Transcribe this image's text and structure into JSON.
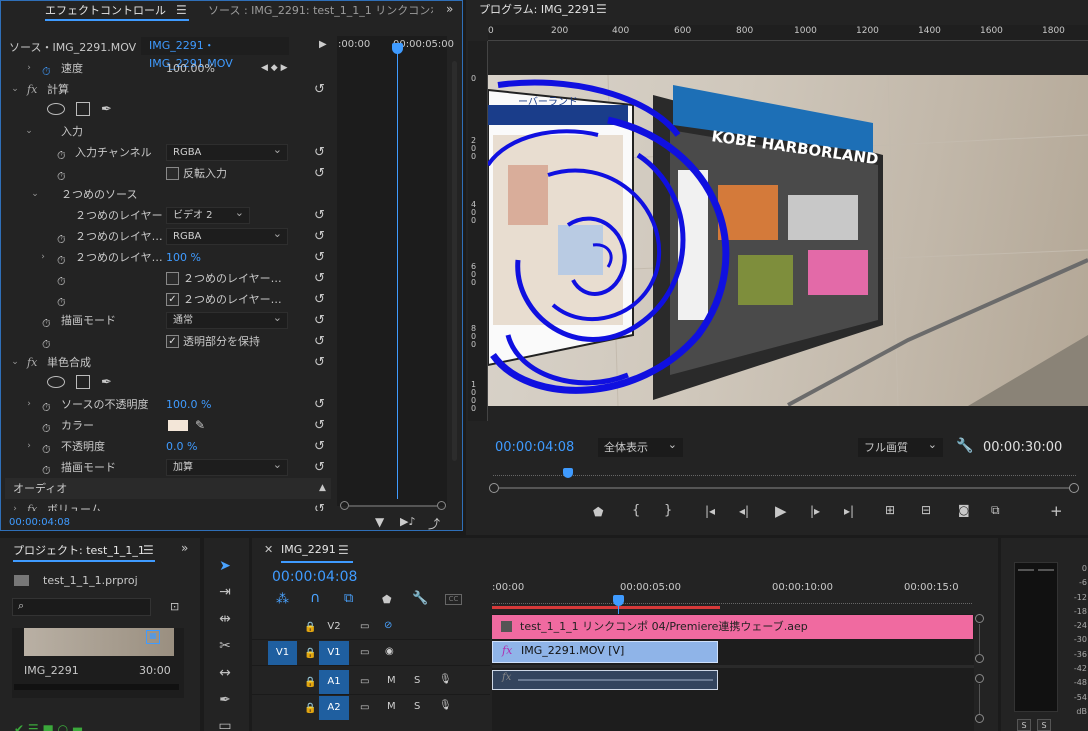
{
  "effect_controls": {
    "tab_title": "エフェクトコントロール",
    "source_tab": "ソース : IMG_2291: test_1_1_1 リンクコンポ (",
    "source_label": "ソース・IMG_2291.MOV",
    "clip_label": "IMG_2291・IMG_2291.MOV",
    "ruler_start": ":00:00",
    "ruler_mid": "00:00:05:00",
    "current_time": "00:00:04:08",
    "rows": {
      "speed_label": "速度",
      "speed_value": "100.00%",
      "calc_label": "計算",
      "input_label": "入力",
      "input_channel_label": "入力チャンネル",
      "input_channel_value": "RGBA",
      "invert_input_label": "反転入力",
      "second_source_label": "２つめのソース",
      "second_layer_label": "２つめのレイヤー",
      "second_layer_value": "ビデオ 2",
      "second_layer_ch_label": "２つめのレイヤ…",
      "second_layer_ch_value": "RGBA",
      "second_layer_op_label": "２つめのレイヤ…",
      "second_layer_op_value": "100 %",
      "second_layer_chk1": "２つめのレイヤー…",
      "second_layer_chk2": "２つめのレイヤー…",
      "blend_mode_label": "描画モード",
      "blend_mode_value": "通常",
      "preserve_alpha_label": "透明部分を保持",
      "solid_composite_label": "単色合成",
      "source_opacity_label": "ソースの不透明度",
      "source_opacity_value": "100.0 %",
      "color_label": "カラー",
      "opacity_label": "不透明度",
      "opacity_value": "0.0 %",
      "blend_mode2_label": "描画モード",
      "blend_mode2_value": "加算",
      "audio_label": "オーディオ",
      "volume_label": "ボリューム"
    }
  },
  "program": {
    "title": "プログラム: IMG_2291",
    "ruler": [
      "0",
      "200",
      "400",
      "600",
      "800",
      "1000",
      "1200",
      "1400",
      "1600",
      "1800"
    ],
    "vruler": [
      "0",
      "200",
      "400",
      "600",
      "800",
      "1000"
    ],
    "sign_text": "KOBE HARBORLAND",
    "map_text": "ーバーランド",
    "timecode": "00:00:04:08",
    "fit_label": "全体表示",
    "quality_label": "フル画質",
    "duration": "00:00:30:00"
  },
  "project": {
    "title": "プロジェクト: test_1_1_1",
    "file": "test_1_1_1.prproj",
    "clip_name": "IMG_2291",
    "clip_duration": "30:00"
  },
  "timeline": {
    "tab": "IMG_2291",
    "timecode": "00:00:04:08",
    "ruler": [
      ":00:00",
      "00:00:05:00",
      "00:00:10:00",
      "00:00:15:0"
    ],
    "tracks": {
      "v2": "V2",
      "v1": "V1",
      "v1_src": "V1",
      "a1": "A1",
      "a2": "A2",
      "m": "M",
      "s": "S"
    },
    "clip_v2": "test_1_1_1 リンクコンポ 04/Premiere連携ウェーブ.aep",
    "clip_v1": "IMG_2291.MOV [V]"
  },
  "meter": {
    "scale": [
      "0",
      "-6",
      "-12",
      "-18",
      "-24",
      "-30",
      "-36",
      "-42",
      "-48",
      "-54",
      "dB"
    ],
    "solo": [
      "S",
      "S"
    ]
  },
  "colors": {
    "accent": "#3f9bff",
    "clip_pink": "#f06aa0",
    "clip_blue": "#8fb4e8",
    "playhead": "#3f9bff",
    "wave": "#1010e0"
  }
}
